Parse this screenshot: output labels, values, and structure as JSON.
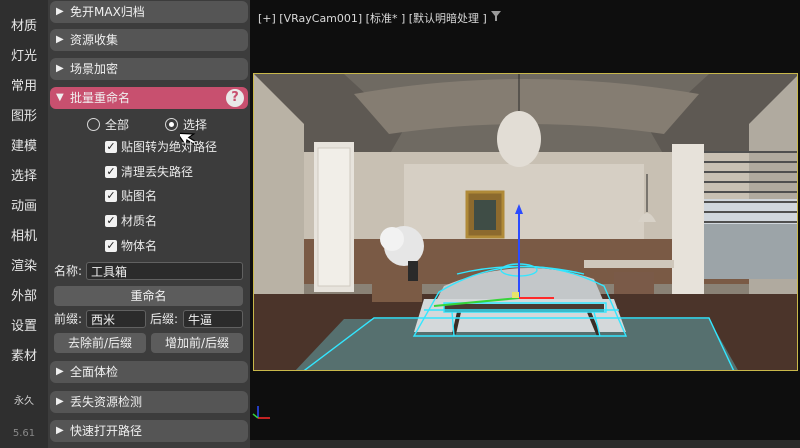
{
  "sidenav": {
    "items": [
      "材质",
      "灯光",
      "常用",
      "图形",
      "建模",
      "选择",
      "动画",
      "相机",
      "渲染",
      "外部",
      "设置",
      "素材"
    ],
    "license": "永久",
    "version": "5.61"
  },
  "panel": {
    "rollouts_top": [
      "免开MAX归档",
      "资源收集",
      "场景加密"
    ],
    "active_rollout": "批量重命名",
    "help_glyph": "?",
    "radio_all": "全部",
    "radio_selected": "选择",
    "radio_value": "选择",
    "checks": [
      "贴图转为绝对路径",
      "清理丢失路径",
      "贴图名",
      "材质名",
      "物体名"
    ],
    "name_label": "名称:",
    "name_value": "工具箱",
    "rename_button": "重命名",
    "prefix_label": "前缀:",
    "prefix_value": "西米",
    "suffix_label": "后缀:",
    "suffix_value": "牛逼",
    "remove_button": "去除前/后缀",
    "add_button": "增加前/后缀",
    "rollouts_bottom": [
      "全面体检",
      "丢失资源检测",
      "快速打开路径"
    ]
  },
  "viewport": {
    "label": "[+] [VRayCam001] [标准* ] [默认明暗处理 ]"
  },
  "colors": {
    "accent": "#c8506f",
    "selection_wire": "#33e6ff",
    "viewport_frame": "#c9b84a",
    "panel_bg": "#3c3c3c"
  },
  "icons": [
    "chevron-right-icon",
    "chevron-down-icon",
    "help-icon",
    "filter-icon",
    "gizmo-axis-icon",
    "mouse-cursor-icon"
  ]
}
